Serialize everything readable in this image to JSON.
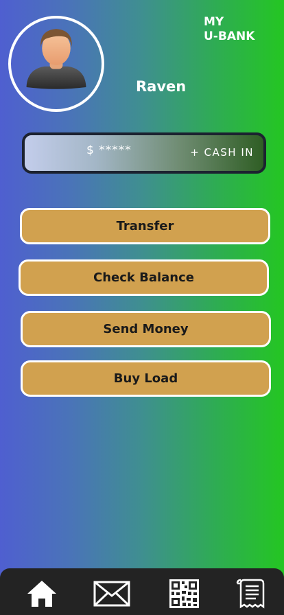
{
  "header": {
    "app_title": "MY\nU-BANK"
  },
  "profile": {
    "name": "Raven",
    "avatar_icon": "user-avatar-icon"
  },
  "balance": {
    "currency": "$",
    "masked_value": "*****",
    "cash_in_label": "+ CASH IN"
  },
  "actions": [
    {
      "label": "Transfer"
    },
    {
      "label": "Check Balance"
    },
    {
      "label": "Send Money"
    },
    {
      "label": "Buy Load"
    }
  ],
  "nav": {
    "items": [
      {
        "icon": "home-icon"
      },
      {
        "icon": "mail-icon"
      },
      {
        "icon": "qr-code-icon"
      },
      {
        "icon": "receipt-icon"
      }
    ]
  },
  "colors": {
    "gradient_start": "#4f5fd0",
    "gradient_end": "#24c622",
    "button_fill": "#d1a14f",
    "nav_background": "#232323"
  }
}
